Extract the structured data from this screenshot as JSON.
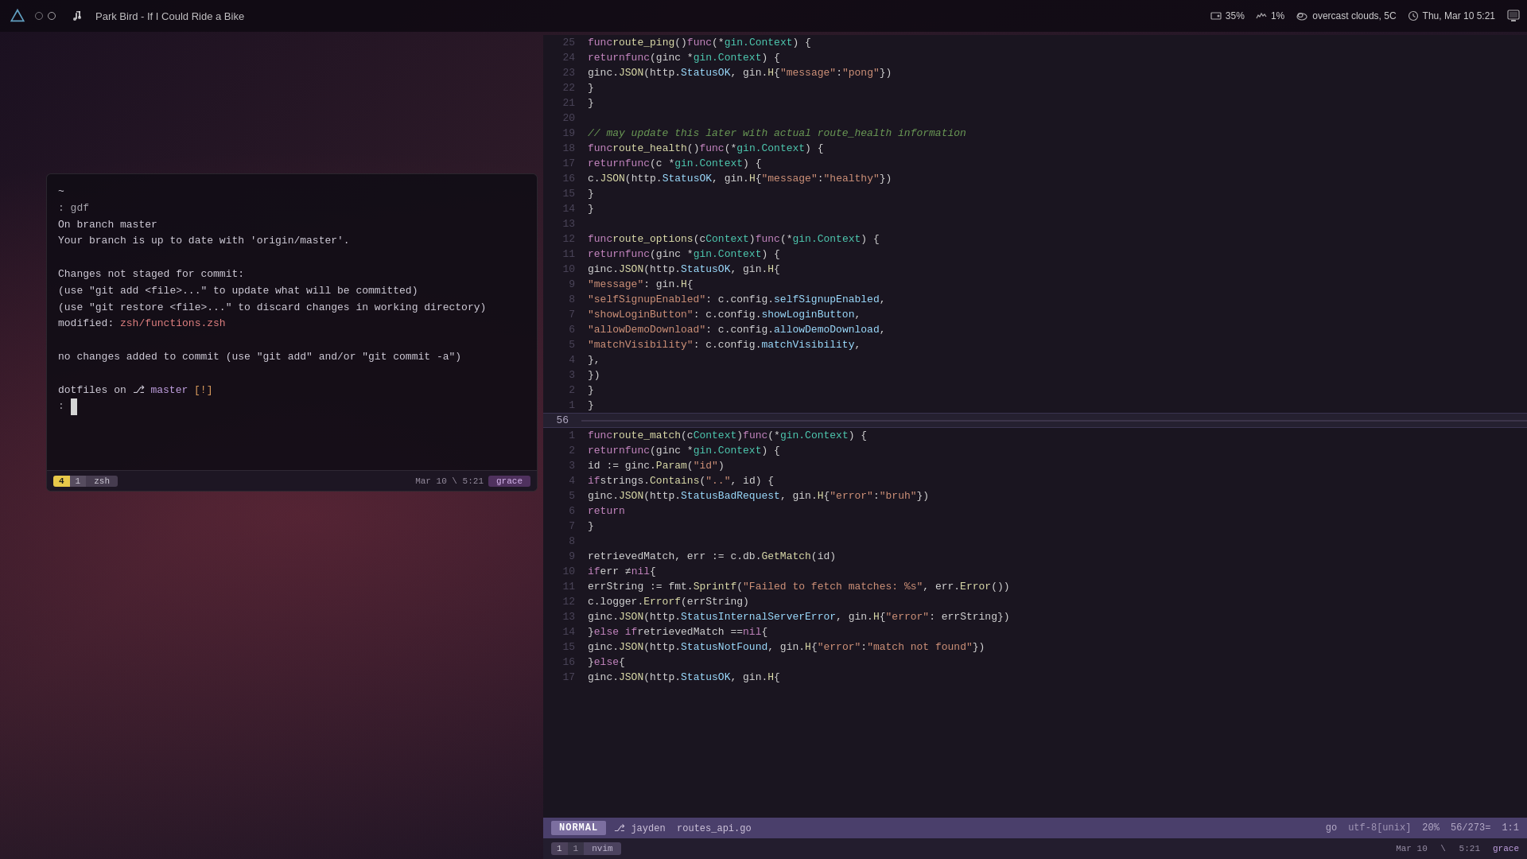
{
  "topbar": {
    "arch_logo": "A",
    "dots": [
      "empty",
      "empty"
    ],
    "music_note": "♫",
    "now_playing": "Park Bird - If I Could Ride a Bike",
    "disk_percent": "35%",
    "cpu_percent": "1%",
    "weather": "overcast clouds, 5C",
    "datetime": "Thu, Mar 10 5:21"
  },
  "terminal": {
    "tilde": "~",
    "prompt1": ": gdf",
    "line1": "On branch master",
    "line2": "Your branch is up to date with 'origin/master'.",
    "line3": "",
    "line4": "Changes not staged for commit:",
    "line5": "  (use \"git add <file>...\" to update what will be committed)",
    "line6": "  (use \"git restore <file>...\" to discard changes in working directory)",
    "line7_pre": "        modified:   ",
    "line7_file": "zsh/functions.zsh",
    "line8": "",
    "line9": "no changes added to commit (use \"git add\" and/or \"git commit -a\")",
    "line10": "",
    "line11_pre": "dotfiles on ",
    "line11_branch_icon": "⎇",
    "line11_branch": " master ",
    "line11_flag": "[!]",
    "prompt2": ": ",
    "cursor": "█",
    "statusbar": {
      "num1": "4",
      "num2": "1",
      "shell": "zsh",
      "date": "Mar 10",
      "time": "5:21",
      "user": "grace"
    }
  },
  "editor": {
    "upper_lines": [
      {
        "num": "25",
        "content": "func route_ping() func(*gin.Context) {"
      },
      {
        "num": "24",
        "content": "    return func(ginc *gin.Context) {"
      },
      {
        "num": "23",
        "content": "        ginc.JSON(http.StatusOK, gin.H{\"message\": \"pong\"})"
      },
      {
        "num": "22",
        "content": "    }"
      },
      {
        "num": "21",
        "content": "}"
      },
      {
        "num": "20",
        "content": ""
      },
      {
        "num": "19",
        "content": "// may update this later with actual route_health information"
      },
      {
        "num": "18",
        "content": "func route_health() func(*gin.Context) {"
      },
      {
        "num": "17",
        "content": "    return func(c *gin.Context) {"
      },
      {
        "num": "16",
        "content": "        c.JSON(http.StatusOK, gin.H{\"message\": \"healthy\"})"
      },
      {
        "num": "15",
        "content": "    }"
      },
      {
        "num": "14",
        "content": "}"
      },
      {
        "num": "13",
        "content": ""
      },
      {
        "num": "12",
        "content": "func route_options(c Context) func(*gin.Context) {"
      },
      {
        "num": "11",
        "content": "    return func(ginc *gin.Context) {"
      },
      {
        "num": "10",
        "content": "        ginc.JSON(http.StatusOK, gin.H{"
      },
      {
        "num": "9",
        "content": "            \"message\": gin.H{"
      },
      {
        "num": "8",
        "content": "                \"selfSignupEnabled\":  c.config.selfSignupEnabled,"
      },
      {
        "num": "7",
        "content": "                \"showLoginButton\":   c.config.showLoginButton,"
      },
      {
        "num": "6",
        "content": "                \"allowDemoDownload\": c.config.allowDemoDownload,"
      },
      {
        "num": "5",
        "content": "                \"matchVisibility\":   c.config.matchVisibility,"
      },
      {
        "num": "4",
        "content": "            },"
      },
      {
        "num": "3",
        "content": "        })"
      },
      {
        "num": "2",
        "content": "    }"
      },
      {
        "num": "1",
        "content": "}"
      }
    ],
    "divider_num": "56",
    "lower_lines": [
      {
        "num": "1",
        "content": "func route_match(c Context) func(*gin.Context) {"
      },
      {
        "num": "2",
        "content": "    return func(ginc *gin.Context) {"
      },
      {
        "num": "3",
        "content": "        id := ginc.Param(\"id\")"
      },
      {
        "num": "4",
        "content": "        if strings.Contains(\"..\", id) {"
      },
      {
        "num": "5",
        "content": "            ginc.JSON(http.StatusBadRequest, gin.H{\"error\": \"bruh\"})"
      },
      {
        "num": "6",
        "content": "            return"
      },
      {
        "num": "7",
        "content": "        }"
      },
      {
        "num": "8",
        "content": ""
      },
      {
        "num": "9",
        "content": "        retrievedMatch, err := c.db.GetMatch(id)"
      },
      {
        "num": "10",
        "content": "        if err ≠ nil {"
      },
      {
        "num": "11",
        "content": "            errString := fmt.Sprintf(\"Failed to fetch matches: %s\", err.Error())"
      },
      {
        "num": "12",
        "content": "            c.logger.Errorf(errString)"
      },
      {
        "num": "13",
        "content": "            ginc.JSON(http.StatusInternalServerError, gin.H{\"error\": errString})"
      },
      {
        "num": "14",
        "content": "        } else if retrievedMatch == nil {"
      },
      {
        "num": "15",
        "content": "            ginc.JSON(http.StatusNotFound, gin.H{\"error\": \"match not found\"})"
      },
      {
        "num": "16",
        "content": "        } else {"
      },
      {
        "num": "17",
        "content": "            ginc.JSON(http.StatusOK, gin.H{"
      }
    ],
    "statusbar": {
      "mode": "NORMAL",
      "branch_icon": "⎇",
      "branch": "jayden",
      "filename": "routes_api.go",
      "lang": "go",
      "encoding": "utf-8[unix]",
      "scroll_pct": "20%",
      "position": "56/273=",
      "cursor_pos": "1:1"
    },
    "tabbar": {
      "num1": "1",
      "num2": "1",
      "name": "nvim",
      "date": "Mar 10",
      "time": "5:21",
      "user": "grace"
    }
  }
}
